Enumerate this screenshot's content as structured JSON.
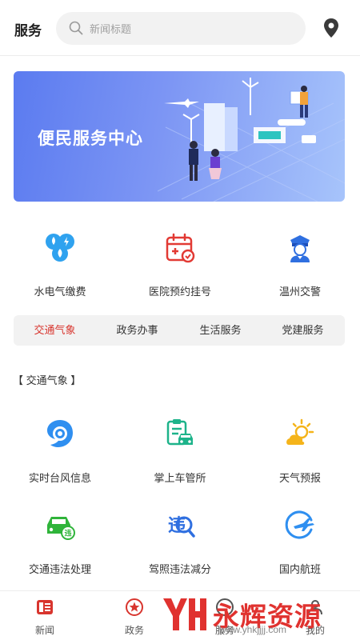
{
  "header": {
    "title": "服务",
    "search_placeholder": "新闻标题"
  },
  "banner": {
    "title": "便民服务中心"
  },
  "services": [
    {
      "label": "水电气缴费",
      "icon": "utilities-icon"
    },
    {
      "label": "医院预约挂号",
      "icon": "calendar-icon"
    },
    {
      "label": "温州交警",
      "icon": "police-icon"
    }
  ],
  "tabs": [
    {
      "label": "交通气象",
      "active": true
    },
    {
      "label": "政务办事",
      "active": false
    },
    {
      "label": "生活服务",
      "active": false
    },
    {
      "label": "党建服务",
      "active": false
    }
  ],
  "section": {
    "title": "【 交通气象 】"
  },
  "grid": [
    {
      "label": "实时台风信息",
      "icon": "typhoon-icon"
    },
    {
      "label": "掌上车管所",
      "icon": "vehicle-office-icon"
    },
    {
      "label": "天气预报",
      "icon": "weather-icon"
    },
    {
      "label": "交通违法处理",
      "icon": "violation-car-icon"
    },
    {
      "label": "驾照违法减分",
      "icon": "license-points-icon"
    },
    {
      "label": "国内航班",
      "icon": "flight-icon"
    }
  ],
  "bottom_nav": [
    {
      "label": "新闻",
      "icon": "news-icon"
    },
    {
      "label": "政务",
      "icon": "government-icon"
    },
    {
      "label": "服务",
      "icon": "service-icon"
    },
    {
      "label": "我的",
      "icon": "profile-icon"
    }
  ],
  "watermark": {
    "text": "永辉资源网",
    "url": "www.yhkjjjj.com"
  },
  "colors": {
    "accent": "#d8352e",
    "blue": "#2f8ff0",
    "green": "#1db38a",
    "yellow": "#f5b41a"
  }
}
